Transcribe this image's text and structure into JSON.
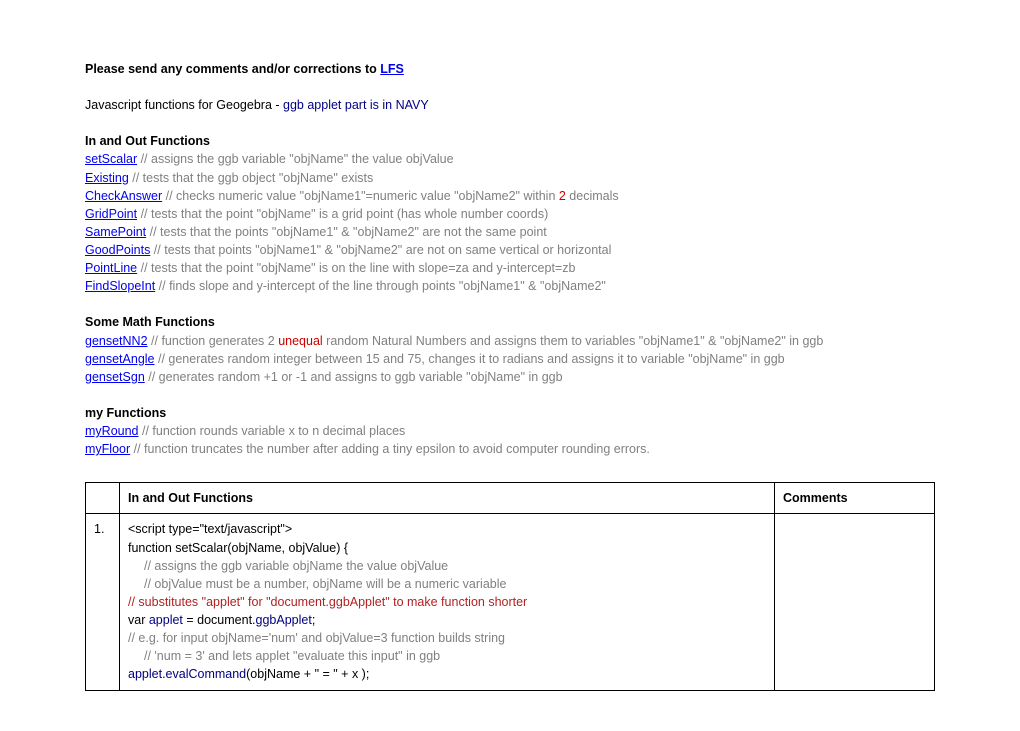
{
  "intro": {
    "prefix": "Please send any comments and/or corrections to ",
    "link": "LFS"
  },
  "title": {
    "prefix": "Javascript functions for Geogebra - ",
    "navy": "ggb applet part is in NAVY"
  },
  "sections": {
    "inout": {
      "heading": "In and Out Functions",
      "items": [
        {
          "link": "setScalar",
          "desc": " // assigns the ggb variable \"objName\" the value objValue"
        },
        {
          "link": "Existing",
          "desc": " // tests that the ggb object \"objName\" exists"
        },
        {
          "link": "CheckAnswer",
          "desc_pre": " // checks numeric value \"objName1\"=numeric value \"objName2\" within ",
          "red": "2",
          "desc_post": " decimals"
        },
        {
          "link": "GridPoint",
          "desc": " // tests that the point \"objName\" is a grid point (has whole number coords)"
        },
        {
          "link": "SamePoint",
          "desc": " // tests that the points \"objName1\" & \"objName2\" are not the same point"
        },
        {
          "link": "GoodPoints",
          "desc": " // tests that points \"objName1\" & \"objName2\" are not on same vertical or horizontal"
        },
        {
          "link": "PointLine",
          "desc": " // tests that the point \"objName\" is on the line with slope=za and y-intercept=zb"
        },
        {
          "link": "FindSlopeInt",
          "desc": " // finds slope and y-intercept of the line through points \"objName1\" & \"objName2\""
        }
      ]
    },
    "math": {
      "heading": "Some Math Functions",
      "items": [
        {
          "link": "gensetNN2",
          "desc_pre": " // function generates 2 ",
          "red": "unequal",
          "desc_post": " random Natural Numbers and assigns them to variables \"objName1\" & \"objName2\" in ggb"
        },
        {
          "link": "gensetAngle",
          "desc": " // generates random integer between 15 and 75, changes it to radians and assigns it to variable \"objName\" in ggb"
        },
        {
          "link": "gensetSgn",
          "desc": " // generates random +1 or -1 and assigns to ggb variable \"objName\"  in ggb"
        }
      ]
    },
    "my": {
      "heading": "my Functions",
      "items": [
        {
          "link": "myRound",
          "desc": " // function rounds variable x to n decimal places"
        },
        {
          "link": "myFloor",
          "desc": " // function truncates the number after adding a tiny epsilon to avoid computer rounding errors."
        }
      ]
    }
  },
  "table": {
    "headers": {
      "h1": "In and Out Functions",
      "h2": "Comments"
    },
    "row1": {
      "num": "1.",
      "l1": "<script type=\"text/javascript\">",
      "l2": "function setScalar(objName, objValue) {",
      "l3": "// assigns the ggb variable objName the value objValue",
      "l4": "// objValue must be a number, objName will be a numeric variable",
      "l5": "// substitutes \"applet\" for \"document.ggbApplet\" to make function shorter",
      "l6a": "var ",
      "l6b": "applet",
      "l6c": " = document.",
      "l6d": "ggbApplet",
      "l6e": ";",
      "l7": "// e.g. for input objName='num' and objValue=3  function builds string",
      "l8": "// 'num = 3' and lets applet \"evaluate this input\" in ggb",
      "l9a": "applet",
      "l9b": ".",
      "l9c": "evalCommand",
      "l9d": "(objName + \" = \" + x );"
    }
  }
}
